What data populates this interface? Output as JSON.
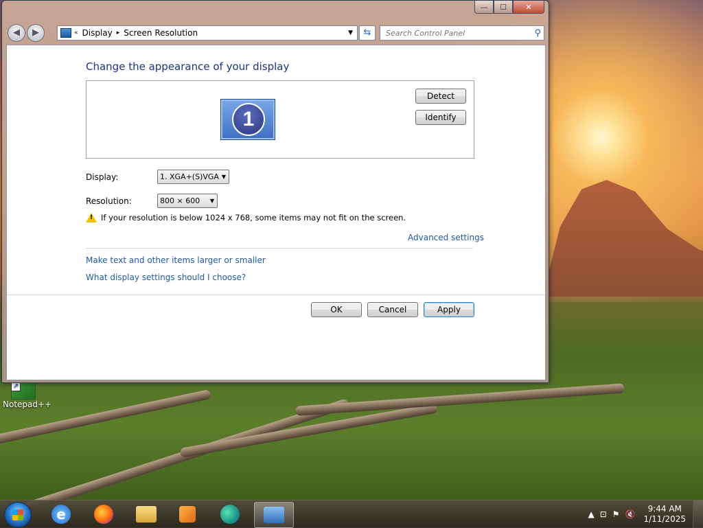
{
  "desktop": {
    "icons": [
      {
        "label": "Notepad++"
      }
    ]
  },
  "window": {
    "caption": {
      "minimize": "—",
      "maximize": "☐",
      "close": "✕"
    },
    "address": {
      "back": "◀",
      "forward": "▶",
      "overflow": "«",
      "segments": [
        "Display",
        "Screen Resolution"
      ],
      "separator": "▸"
    },
    "search": {
      "placeholder": "Search Control Panel"
    },
    "heading": "Change the appearance of your display",
    "monitor_number": "1",
    "buttons": {
      "detect": "Detect",
      "identify": "Identify",
      "ok": "OK",
      "cancel": "Cancel",
      "apply": "Apply"
    },
    "display_label": "Display:",
    "display_value": "1. XGA+(S)VGA",
    "resolution_label": "Resolution:",
    "resolution_value": "800 × 600",
    "warning": "If your resolution is below 1024 x 768, some items may not fit on the screen.",
    "links": {
      "advanced": "Advanced settings",
      "text_size": "Make text and other items larger or smaller",
      "which": "What display settings should I choose?"
    }
  },
  "taskbar": {
    "pinned": [
      "internet-explorer",
      "firefox",
      "file-explorer",
      "media-player",
      "edge",
      "control-panel-display"
    ],
    "tray": {
      "time": "9:44 AM",
      "date": "1/11/2025"
    }
  }
}
